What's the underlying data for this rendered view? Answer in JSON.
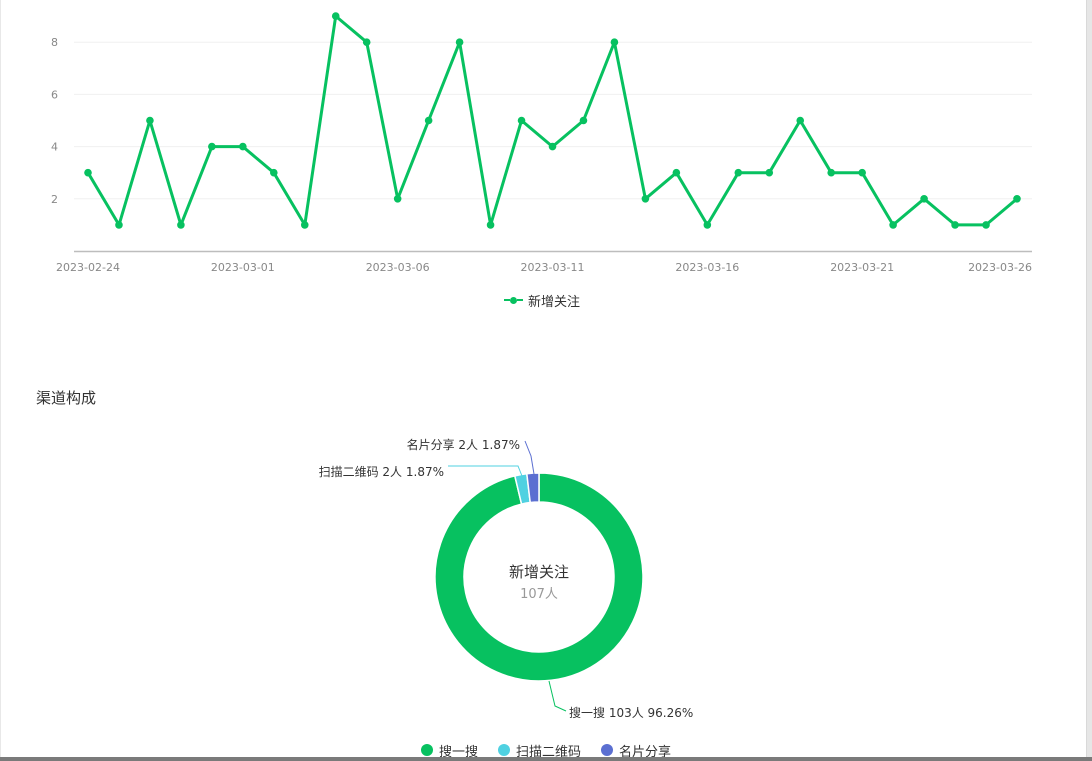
{
  "section_title": "渠道构成",
  "line_legend_label": "新增关注",
  "colors": {
    "green": "#07c160",
    "cyan": "#4fd1e1",
    "blue": "#5b6fd1",
    "grid": "#f0f0f0",
    "axis": "#bdbdbd",
    "tick_text": "#888888"
  },
  "chart_data": [
    {
      "type": "line",
      "x_ticks": [
        "2023-02-24",
        "2023-03-01",
        "2023-03-06",
        "2023-03-11",
        "2023-03-16",
        "2023-03-21",
        "2023-03-26"
      ],
      "x_dates": [
        "2023-02-24",
        "2023-02-25",
        "2023-02-26",
        "2023-02-27",
        "2023-02-28",
        "2023-03-01",
        "2023-03-02",
        "2023-03-03",
        "2023-03-04",
        "2023-03-05",
        "2023-03-06",
        "2023-03-07",
        "2023-03-08",
        "2023-03-09",
        "2023-03-10",
        "2023-03-11",
        "2023-03-12",
        "2023-03-13",
        "2023-03-14",
        "2023-03-15",
        "2023-03-16",
        "2023-03-17",
        "2023-03-18",
        "2023-03-19",
        "2023-03-20",
        "2023-03-21",
        "2023-03-22",
        "2023-03-23",
        "2023-03-24",
        "2023-03-25",
        "2023-03-26"
      ],
      "y_ticks": [
        2,
        4,
        6,
        8
      ],
      "ylim": [
        0,
        9
      ],
      "grid": true,
      "legend_position": "bottom-center",
      "series": [
        {
          "name": "新增关注",
          "values": [
            3,
            1,
            5,
            1,
            4,
            4,
            3,
            1,
            9,
            8,
            2,
            5,
            8,
            1,
            5,
            4,
            5,
            8,
            2,
            3,
            1,
            3,
            3,
            5,
            3,
            3,
            1,
            2,
            1,
            1,
            2
          ]
        }
      ]
    },
    {
      "type": "pie",
      "center_title": "新增关注",
      "center_value": "107人",
      "labels": [
        "搜一搜",
        "扫描二维码",
        "名片分享"
      ],
      "values": [
        103,
        2,
        2
      ],
      "slice_labels": [
        "搜一搜 103人 96.26%",
        "扫描二维码 2人 1.87%",
        "名片分享 2人 1.87%"
      ],
      "legend_position": "bottom-center"
    }
  ]
}
